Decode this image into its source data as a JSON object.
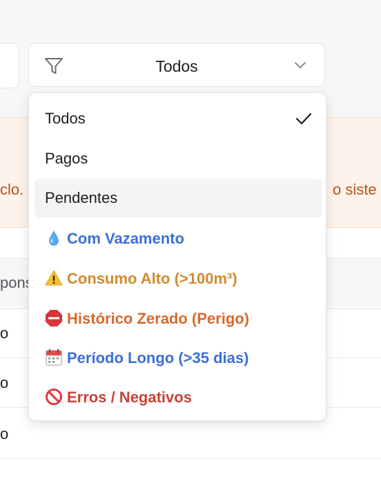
{
  "filter": {
    "selected_label": "Todos",
    "icon": "filter-funnel-icon",
    "chevron": "chevron-down-icon"
  },
  "background": {
    "alert_left_text": "clo.",
    "alert_right_text": "o siste",
    "table_header_text": "pons",
    "row_texts": [
      "o",
      "o",
      "o"
    ]
  },
  "dropdown": {
    "options": [
      {
        "label": "Todos",
        "selected": true,
        "icon": null
      },
      {
        "label": "Pagos",
        "selected": false,
        "icon": null
      },
      {
        "label": "Pendentes",
        "selected": false,
        "highlighted": true,
        "icon": null
      },
      {
        "label": "Com Vazamento",
        "icon": "droplet-icon",
        "color": "#3b6fd9"
      },
      {
        "label": "Consumo Alto (>100m³)",
        "icon": "warning-icon",
        "color": "#d28a2c"
      },
      {
        "label": "Histórico Zerado (Perigo)",
        "icon": "stop-sign-icon",
        "color": "#d9682a"
      },
      {
        "label": "Período Longo (>35 dias)",
        "icon": "calendar-icon",
        "color": "#3b6fd9"
      },
      {
        "label": "Erros / Negativos",
        "icon": "prohibited-icon",
        "color": "#c8413a"
      }
    ]
  },
  "colors": {
    "alert_text": "#b4521f",
    "alert_background": "#fdf3ea",
    "blue": "#3b6fd9",
    "amber": "#d28a2c",
    "orange": "#d9682a",
    "red": "#c8413a"
  }
}
